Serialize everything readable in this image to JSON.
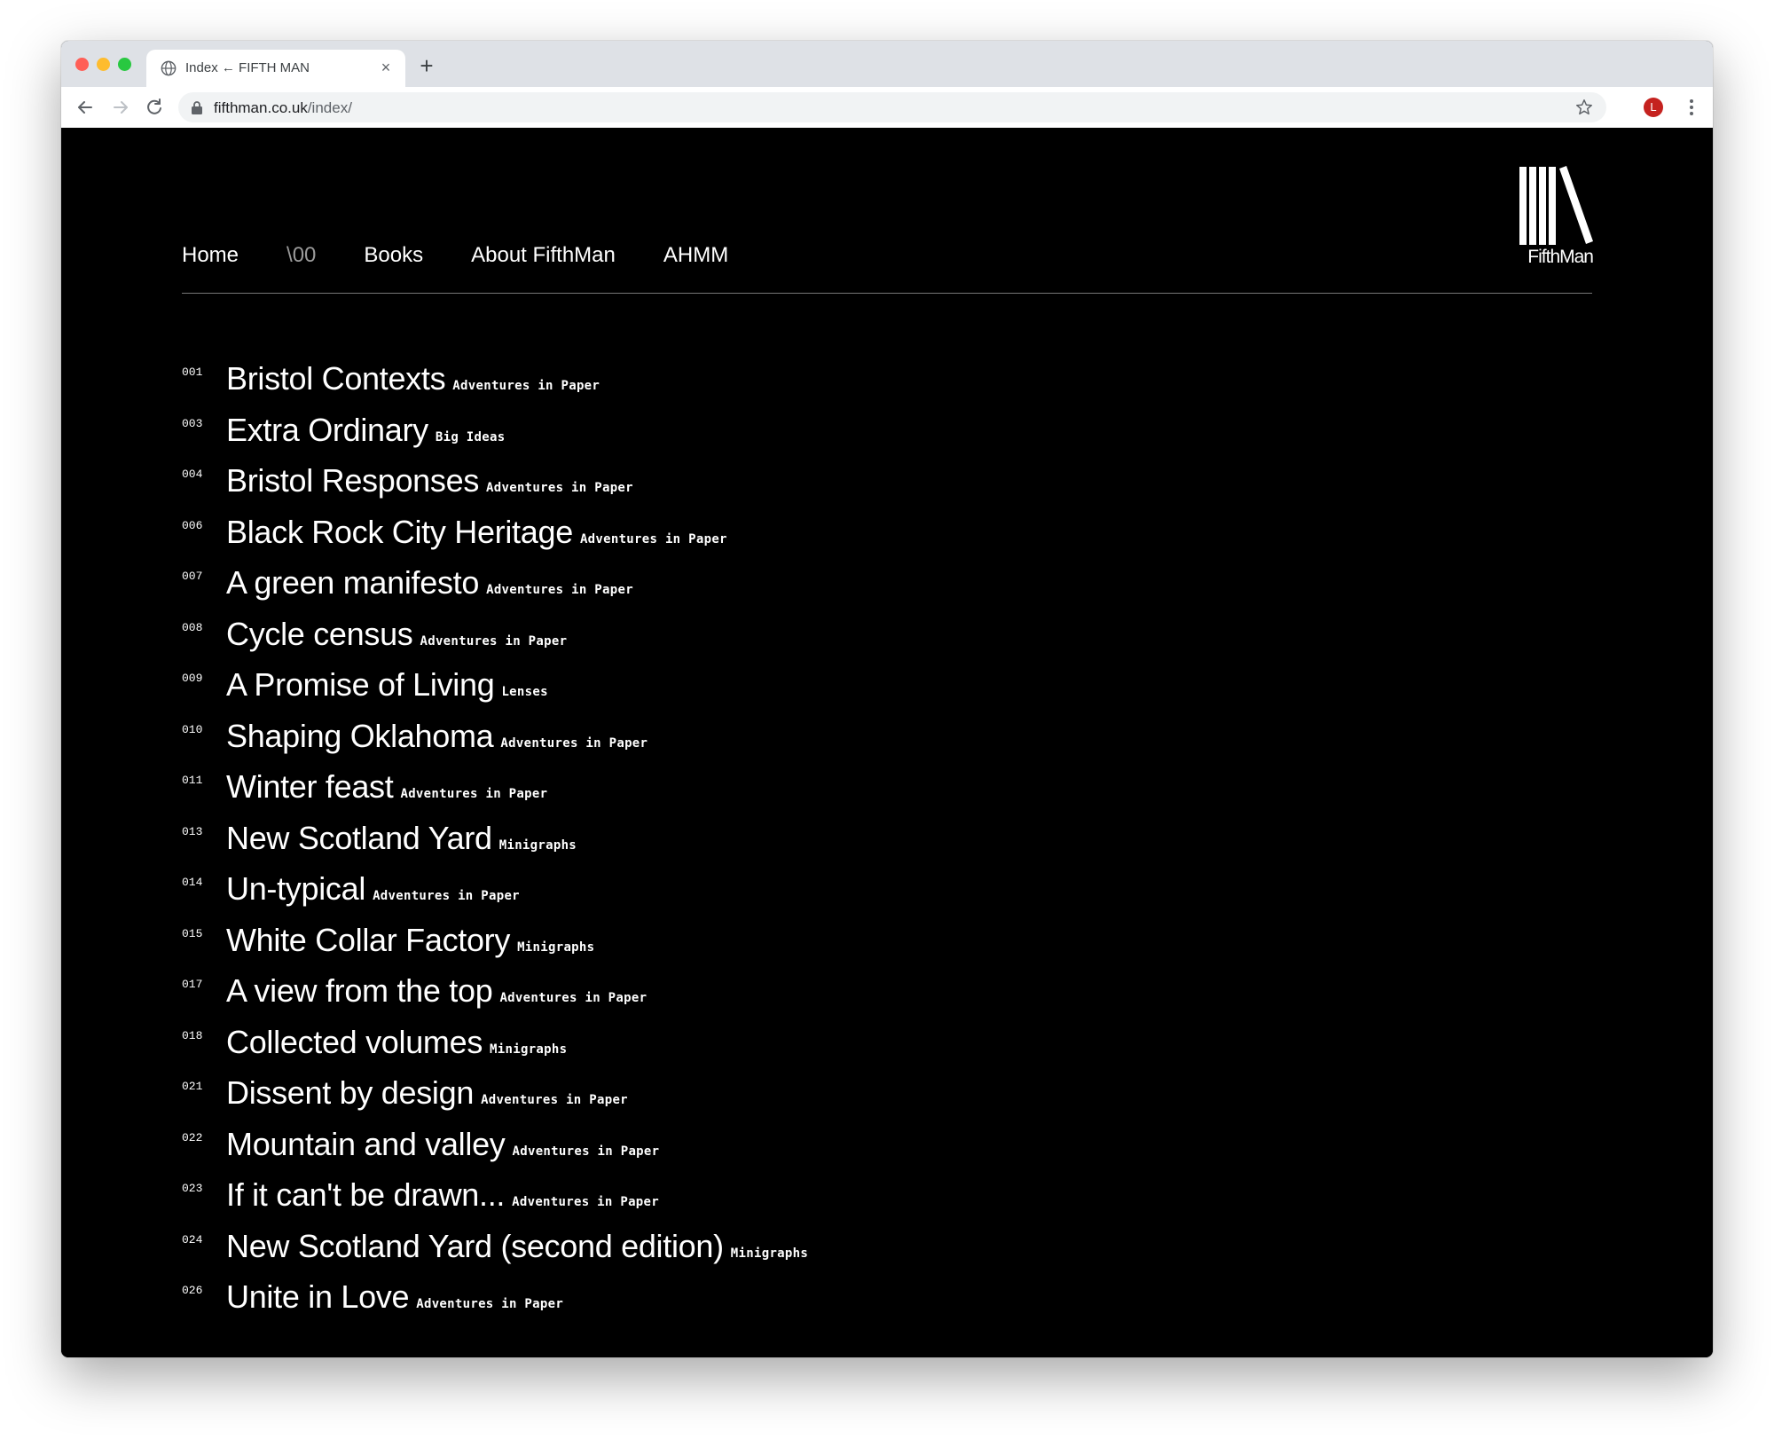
{
  "browser": {
    "tab_title": "Index ← FIFTH MAN",
    "tab_close": "×",
    "new_tab": "+",
    "url_host": "fifthman.co.uk",
    "url_path": "/index/",
    "avatar_initial": "L"
  },
  "site": {
    "nav": [
      {
        "label": "Home"
      },
      {
        "label": "\\00"
      },
      {
        "label": "Books"
      },
      {
        "label": "About FifthMan"
      },
      {
        "label": "AHMM"
      }
    ],
    "logo_text": "FifthMan"
  },
  "index": [
    {
      "num": "001",
      "title": "Bristol Contexts",
      "category": "Adventures in Paper"
    },
    {
      "num": "003",
      "title": "Extra Ordinary",
      "category": "Big Ideas"
    },
    {
      "num": "004",
      "title": "Bristol Responses",
      "category": "Adventures in Paper"
    },
    {
      "num": "006",
      "title": "Black Rock City Heritage",
      "category": "Adventures in Paper"
    },
    {
      "num": "007",
      "title": "A green manifesto",
      "category": "Adventures in Paper"
    },
    {
      "num": "008",
      "title": "Cycle census",
      "category": "Adventures in Paper"
    },
    {
      "num": "009",
      "title": "A Promise of Living",
      "category": "Lenses"
    },
    {
      "num": "010",
      "title": "Shaping Oklahoma",
      "category": "Adventures in Paper"
    },
    {
      "num": "011",
      "title": "Winter feast",
      "category": "Adventures in Paper"
    },
    {
      "num": "013",
      "title": "New Scotland Yard",
      "category": "Minigraphs"
    },
    {
      "num": "014",
      "title": "Un-typical",
      "category": "Adventures in Paper"
    },
    {
      "num": "015",
      "title": "White Collar Factory",
      "category": "Minigraphs"
    },
    {
      "num": "017",
      "title": "A view from the top",
      "category": "Adventures in Paper"
    },
    {
      "num": "018",
      "title": "Collected volumes",
      "category": "Minigraphs"
    },
    {
      "num": "021",
      "title": "Dissent by design",
      "category": "Adventures in Paper"
    },
    {
      "num": "022",
      "title": "Mountain and valley",
      "category": "Adventures in Paper"
    },
    {
      "num": "023",
      "title": "If it can't be drawn...",
      "category": "Adventures in Paper"
    },
    {
      "num": "024",
      "title": "New Scotland Yard (second edition)",
      "category": "Minigraphs"
    },
    {
      "num": "026",
      "title": "Unite in Love",
      "category": "Adventures in Paper"
    }
  ],
  "colors": {
    "page_bg": "#000000",
    "text": "#ffffff",
    "nav_muted": "#9a9a9a",
    "avatar": "#c5221f"
  }
}
